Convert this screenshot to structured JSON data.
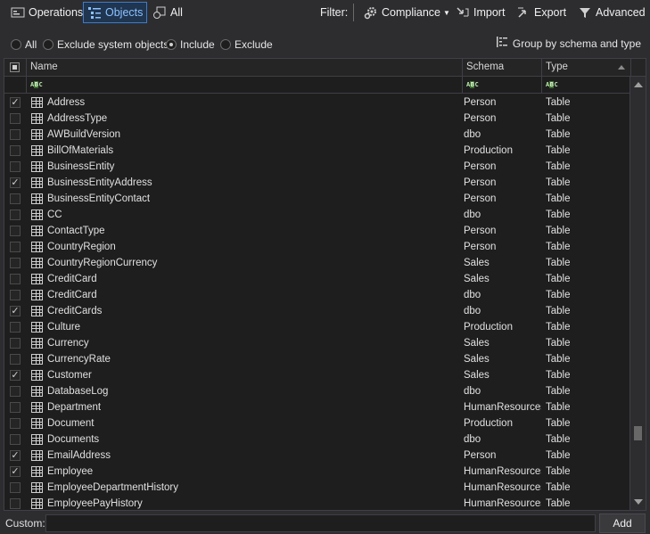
{
  "toolbar": {
    "operations_label": "Operations",
    "objects_label": "Objects",
    "all_label": "All",
    "filter_label": "Filter:",
    "compliance_label": "Compliance",
    "import_label": "Import",
    "export_label": "Export",
    "advanced_label": "Advanced"
  },
  "filters": {
    "all_label": "All",
    "exclude_system_label": "Exclude system objects",
    "include_label": "Include",
    "exclude_label": "Exclude",
    "group_label": "Group by schema and type"
  },
  "grid": {
    "columns": [
      "Name",
      "Schema",
      "Type"
    ],
    "filter_glyph": "abc",
    "rows": [
      {
        "checked": true,
        "name": "Address",
        "schema": "Person",
        "type": "Table"
      },
      {
        "checked": false,
        "name": "AddressType",
        "schema": "Person",
        "type": "Table"
      },
      {
        "checked": false,
        "name": "AWBuildVersion",
        "schema": "dbo",
        "type": "Table"
      },
      {
        "checked": false,
        "name": "BillOfMaterials",
        "schema": "Production",
        "type": "Table"
      },
      {
        "checked": false,
        "name": "BusinessEntity",
        "schema": "Person",
        "type": "Table"
      },
      {
        "checked": true,
        "name": "BusinessEntityAddress",
        "schema": "Person",
        "type": "Table"
      },
      {
        "checked": false,
        "name": "BusinessEntityContact",
        "schema": "Person",
        "type": "Table"
      },
      {
        "checked": false,
        "name": "CC",
        "schema": "dbo",
        "type": "Table"
      },
      {
        "checked": false,
        "name": "ContactType",
        "schema": "Person",
        "type": "Table"
      },
      {
        "checked": false,
        "name": "CountryRegion",
        "schema": "Person",
        "type": "Table"
      },
      {
        "checked": false,
        "name": "CountryRegionCurrency",
        "schema": "Sales",
        "type": "Table"
      },
      {
        "checked": false,
        "name": "CreditCard",
        "schema": "Sales",
        "type": "Table"
      },
      {
        "checked": false,
        "name": "CreditCard",
        "schema": "dbo",
        "type": "Table"
      },
      {
        "checked": true,
        "name": "CreditCards",
        "schema": "dbo",
        "type": "Table"
      },
      {
        "checked": false,
        "name": "Culture",
        "schema": "Production",
        "type": "Table"
      },
      {
        "checked": false,
        "name": "Currency",
        "schema": "Sales",
        "type": "Table"
      },
      {
        "checked": false,
        "name": "CurrencyRate",
        "schema": "Sales",
        "type": "Table"
      },
      {
        "checked": true,
        "name": "Customer",
        "schema": "Sales",
        "type": "Table"
      },
      {
        "checked": false,
        "name": "DatabaseLog",
        "schema": "dbo",
        "type": "Table"
      },
      {
        "checked": false,
        "name": "Department",
        "schema": "HumanResources",
        "type": "Table"
      },
      {
        "checked": false,
        "name": "Document",
        "schema": "Production",
        "type": "Table"
      },
      {
        "checked": false,
        "name": "Documents",
        "schema": "dbo",
        "type": "Table"
      },
      {
        "checked": true,
        "name": "EmailAddress",
        "schema": "Person",
        "type": "Table"
      },
      {
        "checked": true,
        "name": "Employee",
        "schema": "HumanResources",
        "type": "Table"
      },
      {
        "checked": false,
        "name": "EmployeeDepartmentHistory",
        "schema": "HumanResources",
        "type": "Table"
      },
      {
        "checked": false,
        "name": "EmployeePayHistory",
        "schema": "HumanResources",
        "type": "Table"
      }
    ]
  },
  "bottom": {
    "custom_label": "Custom:",
    "custom_value": "",
    "add_label": "Add"
  }
}
